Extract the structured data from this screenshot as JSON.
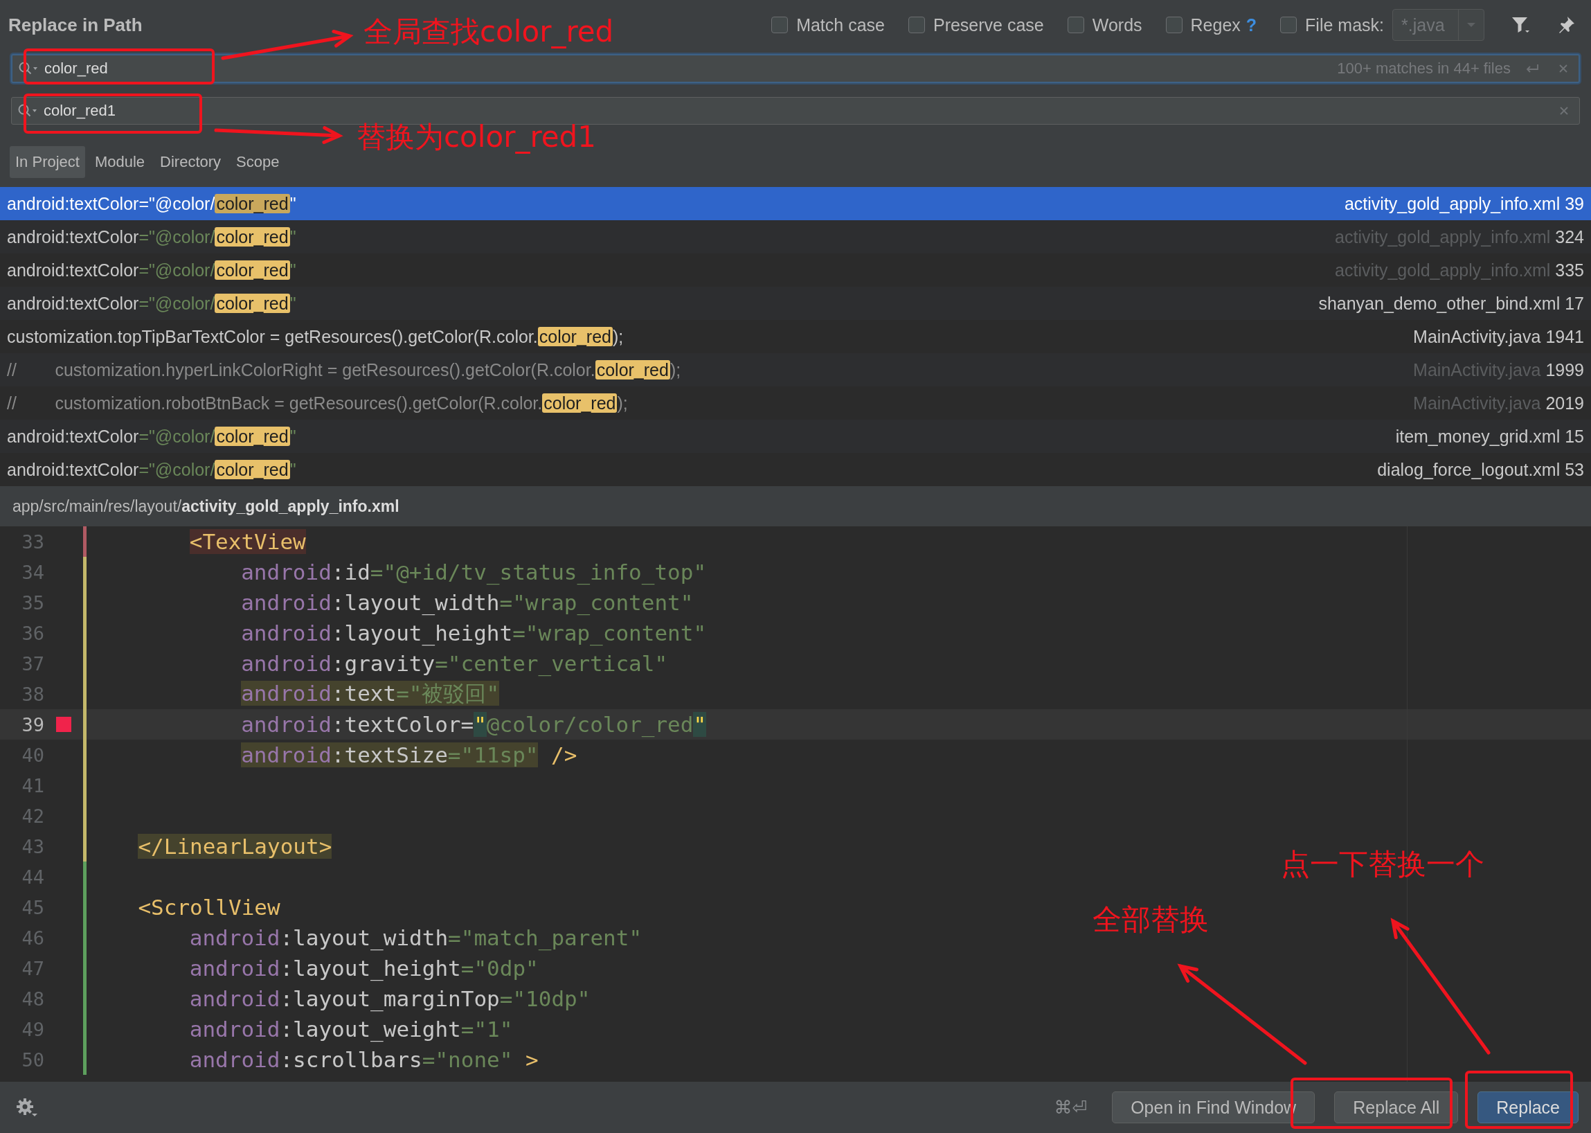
{
  "title": "Replace in Path",
  "options": [
    {
      "label": "Match case",
      "checked": false
    },
    {
      "label": "Preserve case",
      "checked": false
    },
    {
      "label": "Words",
      "checked": false
    },
    {
      "label": "Regex",
      "checked": false,
      "help": "?"
    }
  ],
  "file_mask": {
    "checked": false,
    "label": "File mask:",
    "value": "*.java"
  },
  "search": {
    "value": "color_red",
    "status": "100+ matches in 44+ files"
  },
  "replace": {
    "value": "color_red1"
  },
  "scopes": [
    {
      "label": "In Project",
      "selected": true
    },
    {
      "label": "Module",
      "selected": false
    },
    {
      "label": "Directory",
      "selected": false
    },
    {
      "label": "Scope",
      "selected": false
    }
  ],
  "results": [
    {
      "selected": true,
      "file_dim": false,
      "file": "activity_gold_apply_info.xml",
      "line": "39",
      "parts": [
        {
          "text": "android:textColor",
          "kind": "plain"
        },
        {
          "text": "=\"@color/",
          "kind": "string"
        },
        {
          "text": "color_red",
          "kind": "match"
        },
        {
          "text": "\"",
          "kind": "string"
        }
      ]
    },
    {
      "selected": false,
      "file_dim": true,
      "file": "activity_gold_apply_info.xml",
      "line": "324",
      "parts": [
        {
          "text": "android:textColor",
          "kind": "plain"
        },
        {
          "text": "=\"@color/",
          "kind": "string"
        },
        {
          "text": "color_red",
          "kind": "match"
        },
        {
          "text": "\"",
          "kind": "string"
        }
      ]
    },
    {
      "selected": false,
      "file_dim": true,
      "file": "activity_gold_apply_info.xml",
      "line": "335",
      "parts": [
        {
          "text": "android:textColor",
          "kind": "plain"
        },
        {
          "text": "=\"@color/",
          "kind": "string"
        },
        {
          "text": "color_red",
          "kind": "match"
        },
        {
          "text": "\"",
          "kind": "string"
        }
      ]
    },
    {
      "selected": false,
      "file_dim": false,
      "file": "shanyan_demo_other_bind.xml",
      "line": "17",
      "parts": [
        {
          "text": "android:textColor",
          "kind": "plain"
        },
        {
          "text": "=\"@color/",
          "kind": "string"
        },
        {
          "text": "color_red",
          "kind": "match"
        },
        {
          "text": "\"",
          "kind": "string"
        }
      ]
    },
    {
      "selected": false,
      "file_dim": false,
      "file": "MainActivity.java",
      "line": "1941",
      "parts": [
        {
          "text": "customization.topTipBarTextColor = getResources().getColor(R.color.",
          "kind": "plain"
        },
        {
          "text": "color_red",
          "kind": "match"
        },
        {
          "text": ");",
          "kind": "plain"
        }
      ]
    },
    {
      "selected": false,
      "file_dim": true,
      "file": "MainActivity.java",
      "line": "1999",
      "parts": [
        {
          "text": "//        customization.hyperLinkColorRight = getResources().getColor(R.color.",
          "kind": "comment"
        },
        {
          "text": "color_red",
          "kind": "match"
        },
        {
          "text": ");",
          "kind": "comment"
        }
      ]
    },
    {
      "selected": false,
      "file_dim": true,
      "file": "MainActivity.java",
      "line": "2019",
      "parts": [
        {
          "text": "//        customization.robotBtnBack = getResources().getColor(R.color.",
          "kind": "comment"
        },
        {
          "text": "color_red",
          "kind": "match"
        },
        {
          "text": ");",
          "kind": "comment"
        }
      ]
    },
    {
      "selected": false,
      "file_dim": false,
      "file": "item_money_grid.xml",
      "line": "15",
      "parts": [
        {
          "text": "android:textColor",
          "kind": "plain"
        },
        {
          "text": "=\"@color/",
          "kind": "string"
        },
        {
          "text": "color_red",
          "kind": "match"
        },
        {
          "text": "\"",
          "kind": "string"
        }
      ]
    },
    {
      "selected": false,
      "file_dim": false,
      "file": "dialog_force_logout.xml",
      "line": "53",
      "parts": [
        {
          "text": "android:textColor",
          "kind": "plain"
        },
        {
          "text": "=\"@color/",
          "kind": "string"
        },
        {
          "text": "color_red",
          "kind": "match"
        },
        {
          "text": "\"",
          "kind": "string"
        }
      ]
    }
  ],
  "path": "app/src/main/res/layout/**activity_gold_apply_info.xml**",
  "editor": [
    {
      "n": "33",
      "change": {
        "kind": "removed"
      },
      "current": false,
      "breakpoint": false,
      "kind": "inner_tag",
      "tokens": [
        {
          "text": "<TextView",
          "kind": "tag",
          "highlight": {
            "kind": "red"
          }
        }
      ]
    },
    {
      "n": "34",
      "change": {
        "kind": "modified"
      },
      "current": false,
      "breakpoint": false,
      "kind": "inner_attr",
      "tokens": [
        {
          "text": "android",
          "kind": "ns"
        },
        {
          "text": ":id",
          "kind": "plain"
        },
        {
          "text": "=\"@+id/tv_status_info_top\"",
          "kind": "value"
        }
      ]
    },
    {
      "n": "35",
      "change": {
        "kind": "modified"
      },
      "current": false,
      "breakpoint": false,
      "kind": "inner_attr",
      "tokens": [
        {
          "text": "android",
          "kind": "ns"
        },
        {
          "text": ":layout_width",
          "kind": "plain"
        },
        {
          "text": "=\"wrap_content\"",
          "kind": "value"
        }
      ]
    },
    {
      "n": "36",
      "change": {
        "kind": "modified"
      },
      "current": false,
      "breakpoint": false,
      "kind": "inner_attr",
      "tokens": [
        {
          "text": "android",
          "kind": "ns"
        },
        {
          "text": ":layout_height",
          "kind": "plain"
        },
        {
          "text": "=\"wrap_content\"",
          "kind": "value"
        }
      ]
    },
    {
      "n": "37",
      "change": {
        "kind": "modified"
      },
      "current": false,
      "breakpoint": false,
      "kind": "inner_attr",
      "tokens": [
        {
          "text": "android",
          "kind": "ns"
        },
        {
          "text": ":gravity",
          "kind": "plain"
        },
        {
          "text": "=\"center_vertical\"",
          "kind": "value"
        }
      ]
    },
    {
      "n": "38",
      "change": {
        "kind": "modified"
      },
      "current": false,
      "breakpoint": false,
      "kind": "inner_attr",
      "tokens": [
        {
          "text": "android",
          "kind": "ns",
          "highlight": {
            "kind": "olive"
          }
        },
        {
          "text": ":text",
          "kind": "plain",
          "highlight": {
            "kind": "olive"
          }
        },
        {
          "text": "=\"被驳回\"",
          "kind": "value",
          "highlight": {
            "kind": "olive"
          }
        }
      ]
    },
    {
      "n": "39",
      "change": {
        "kind": "modified"
      },
      "current": true,
      "breakpoint": true,
      "kind": "inner_attr",
      "tokens": [
        {
          "text": "android",
          "kind": "ns"
        },
        {
          "text": ":textColor=",
          "kind": "plain"
        },
        {
          "text": "\"",
          "kind": "quote",
          "highlight": {
            "kind": "teal"
          }
        },
        {
          "text": "@color/color_red",
          "kind": "value"
        },
        {
          "text": "\"",
          "kind": "quote",
          "highlight": {
            "kind": "teal"
          }
        }
      ]
    },
    {
      "n": "40",
      "change": {
        "kind": "modified"
      },
      "current": false,
      "breakpoint": false,
      "kind": "inner_attr",
      "tokens": [
        {
          "text": "android",
          "kind": "ns",
          "highlight": {
            "kind": "olive"
          }
        },
        {
          "text": ":textSize",
          "kind": "plain",
          "highlight": {
            "kind": "olive"
          }
        },
        {
          "text": "=\"11sp\"",
          "kind": "value",
          "highlight": {
            "kind": "olive"
          }
        },
        {
          "text": "/>",
          "kind": "tag"
        }
      ]
    },
    {
      "n": "41",
      "change": {
        "kind": "modified"
      },
      "current": false,
      "breakpoint": false,
      "kind": "blank"
    },
    {
      "n": "42",
      "change": {
        "kind": "modified"
      },
      "current": false,
      "breakpoint": false,
      "kind": "blank"
    },
    {
      "n": "43",
      "change": {
        "kind": "modified"
      },
      "current": false,
      "breakpoint": false,
      "kind": "outer_tag",
      "tokens": [
        {
          "text": "</LinearLayout>",
          "kind": "tag",
          "highlight": {
            "kind": "olive"
          }
        }
      ]
    },
    {
      "n": "44",
      "change": {
        "kind": "added"
      },
      "current": false,
      "breakpoint": false,
      "kind": "blank"
    },
    {
      "n": "45",
      "change": {
        "kind": "added"
      },
      "current": false,
      "breakpoint": false,
      "kind": "outer_tag",
      "tokens": [
        {
          "text": "<ScrollView",
          "kind": "tag"
        }
      ]
    },
    {
      "n": "46",
      "change": {
        "kind": "added"
      },
      "current": false,
      "breakpoint": false,
      "kind": "outer_attr",
      "tokens": [
        {
          "text": "android",
          "kind": "ns"
        },
        {
          "text": ":layout_width",
          "kind": "plain"
        },
        {
          "text": "=\"match_parent\"",
          "kind": "value"
        }
      ]
    },
    {
      "n": "47",
      "change": {
        "kind": "added"
      },
      "current": false,
      "breakpoint": false,
      "kind": "outer_attr",
      "tokens": [
        {
          "text": "android",
          "kind": "ns"
        },
        {
          "text": ":layout_height",
          "kind": "plain"
        },
        {
          "text": "=\"0dp\"",
          "kind": "value"
        }
      ]
    },
    {
      "n": "48",
      "change": {
        "kind": "added"
      },
      "current": false,
      "breakpoint": false,
      "kind": "outer_attr",
      "tokens": [
        {
          "text": "android",
          "kind": "ns"
        },
        {
          "text": ":layout_marginTop",
          "kind": "plain"
        },
        {
          "text": "=\"10dp\"",
          "kind": "value"
        }
      ]
    },
    {
      "n": "49",
      "change": {
        "kind": "added"
      },
      "current": false,
      "breakpoint": false,
      "kind": "outer_attr",
      "tokens": [
        {
          "text": "android",
          "kind": "ns"
        },
        {
          "text": ":layout_weight",
          "kind": "plain"
        },
        {
          "text": "=\"1\"",
          "kind": "value"
        }
      ]
    },
    {
      "n": "50",
      "change": {
        "kind": "added"
      },
      "current": false,
      "breakpoint": false,
      "kind": "outer_attr",
      "tokens": [
        {
          "text": "android",
          "kind": "ns"
        },
        {
          "text": ":scrollbars",
          "kind": "plain"
        },
        {
          "text": "=\"none\"",
          "kind": "value"
        },
        {
          "text": ">",
          "kind": "tag"
        }
      ]
    }
  ],
  "shortcut": "⌘⏎",
  "buttons": [
    {
      "label": "Open in Find Window",
      "kind": "default"
    },
    {
      "label": "Replace All",
      "kind": "default"
    },
    {
      "label": "Replace",
      "kind": "primary"
    }
  ],
  "annotations": [
    {
      "text": "全局查找color_red"
    },
    {
      "text": "替换为color_red1"
    },
    {
      "text": "全部替换"
    },
    {
      "text": "点一下替换一个"
    }
  ]
}
